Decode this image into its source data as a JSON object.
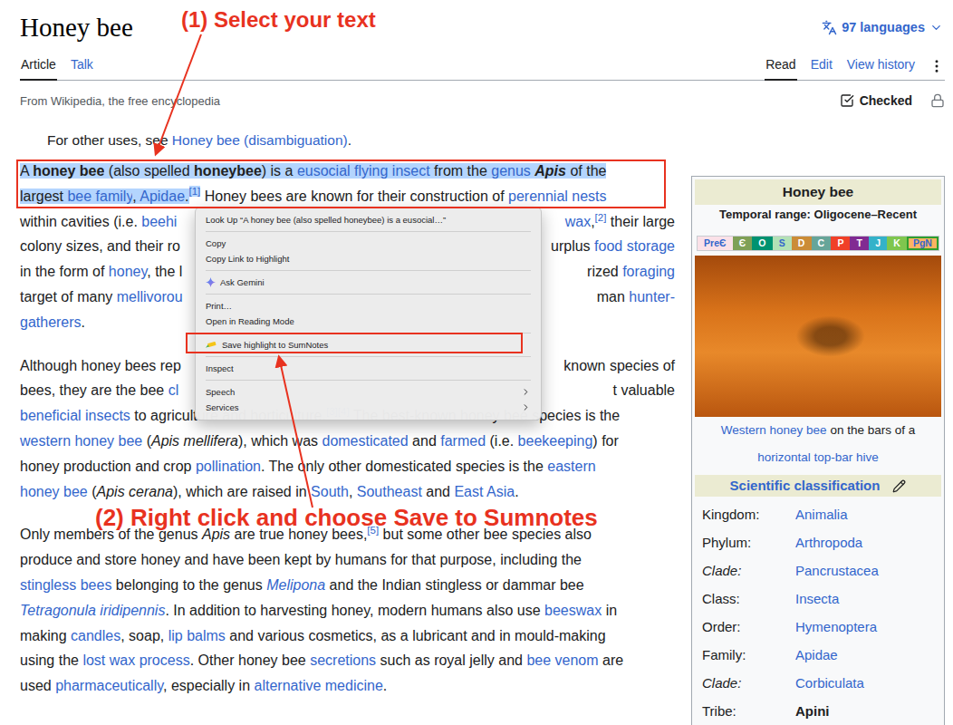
{
  "window": {
    "title": "Honey bee"
  },
  "header": {
    "title": "Honey bee",
    "languages": "97 languages"
  },
  "tabs_left": [
    {
      "label": "Article",
      "selected": true
    },
    {
      "label": "Talk",
      "selected": false
    }
  ],
  "tabs_right": [
    {
      "label": "Read",
      "selected": true
    },
    {
      "label": "Edit",
      "selected": false
    },
    {
      "label": "View history",
      "selected": false
    }
  ],
  "tagline": "From Wikipedia, the free encyclopedia",
  "status": {
    "label": "Checked"
  },
  "hatnote": [
    {
      "t": "For other uses, see ",
      "kind": "plain"
    },
    {
      "t": "Honey bee (disambiguation)",
      "kind": "link"
    },
    {
      "t": ".",
      "kind": "plain"
    }
  ],
  "paragraphs": [
    [
      {
        "covered": false,
        "parts": [
          {
            "t": "A ",
            "kind": "plain",
            "selected": true
          },
          {
            "t": "honey bee",
            "kind": "bold",
            "selected": true
          },
          {
            "t": " (also spelled ",
            "kind": "plain",
            "selected": true
          },
          {
            "t": "honeybee",
            "kind": "bold",
            "selected": true
          },
          {
            "t": ") is a ",
            "kind": "plain",
            "selected": true
          },
          {
            "t": "eusocial flying insect",
            "kind": "link",
            "selected": true
          },
          {
            "t": " from the ",
            "kind": "plain",
            "selected": true
          },
          {
            "t": "genus",
            "kind": "link",
            "selected": true
          },
          {
            "t": " ",
            "kind": "plain",
            "selected": true
          },
          {
            "t": "Apis",
            "kind": "bold-italic",
            "selected": true
          },
          {
            "t": " of the",
            "kind": "plain",
            "selected": true
          }
        ],
        "after": []
      },
      {
        "covered": false,
        "parts": [
          {
            "t": "largest ",
            "kind": "plain",
            "selected": true
          },
          {
            "t": "bee family",
            "kind": "link",
            "selected": true
          },
          {
            "t": ", ",
            "kind": "plain",
            "selected": true
          },
          {
            "t": "Apidae",
            "kind": "link",
            "selected": true
          },
          {
            "t": ".",
            "kind": "plain",
            "selected": true
          },
          {
            "t": "[1]",
            "kind": "ref",
            "selected": true
          },
          {
            "t": " Honey bees are known for their construction of ",
            "kind": "plain",
            "selected": false
          },
          {
            "t": "perennial nests",
            "kind": "link",
            "selected": false
          }
        ],
        "after": []
      },
      {
        "covered": true,
        "parts": [
          {
            "t": "within cavities (i.e. ",
            "kind": "plain"
          },
          {
            "t": "beehi",
            "kind": "link"
          }
        ],
        "after": [
          {
            "t": "wax",
            "kind": "link"
          },
          {
            "t": ",",
            "kind": "plain"
          },
          {
            "t": "[2]",
            "kind": "ref"
          },
          {
            "t": " their large",
            "kind": "plain"
          }
        ]
      },
      {
        "covered": true,
        "parts": [
          {
            "t": "colony sizes, and their ro",
            "kind": "plain"
          }
        ],
        "after": [
          {
            "t": "urplus ",
            "kind": "plain"
          },
          {
            "t": "food storage",
            "kind": "link"
          }
        ]
      },
      {
        "covered": true,
        "parts": [
          {
            "t": "in the form of ",
            "kind": "plain"
          },
          {
            "t": "honey",
            "kind": "link"
          },
          {
            "t": ", the l",
            "kind": "plain"
          }
        ],
        "after": [
          {
            "t": "rized ",
            "kind": "plain"
          },
          {
            "t": "foraging",
            "kind": "link"
          }
        ]
      },
      {
        "covered": true,
        "parts": [
          {
            "t": "target of many ",
            "kind": "plain"
          },
          {
            "t": "mellivorou",
            "kind": "link"
          }
        ],
        "after": [
          {
            "t": "man ",
            "kind": "plain"
          },
          {
            "t": "hunter-",
            "kind": "link"
          }
        ]
      },
      {
        "covered": false,
        "parts": [
          {
            "t": "gatherers",
            "kind": "link"
          },
          {
            "t": ".",
            "kind": "plain"
          }
        ],
        "after": []
      }
    ],
    [
      {
        "covered": true,
        "parts": [
          {
            "t": "Although honey bees rep",
            "kind": "plain"
          }
        ],
        "after": [
          {
            "t": "known species of",
            "kind": "plain"
          }
        ]
      },
      {
        "covered": true,
        "parts": [
          {
            "t": "bees, they are the bee ",
            "kind": "plain"
          },
          {
            "t": "cl",
            "kind": "link"
          }
        ],
        "after": [
          {
            "t": "t valuable",
            "kind": "plain"
          }
        ]
      },
      {
        "covered": false,
        "parts": [
          {
            "t": "beneficial insects",
            "kind": "link"
          },
          {
            "t": " to agriculture and horticulture.",
            "kind": "plain"
          },
          {
            "t": "[3][4]",
            "kind": "ref"
          },
          {
            "t": " The best-known honey bee species is the",
            "kind": "plain"
          }
        ],
        "after": []
      },
      {
        "covered": false,
        "parts": [
          {
            "t": "western honey bee",
            "kind": "link"
          },
          {
            "t": " (",
            "kind": "plain"
          },
          {
            "t": "Apis mellifera",
            "kind": "italic"
          },
          {
            "t": "), which was ",
            "kind": "plain"
          },
          {
            "t": "domesticated",
            "kind": "link"
          },
          {
            "t": " and ",
            "kind": "plain"
          },
          {
            "t": "farmed",
            "kind": "link"
          },
          {
            "t": " (i.e. ",
            "kind": "plain"
          },
          {
            "t": "beekeeping",
            "kind": "link"
          },
          {
            "t": ") for",
            "kind": "plain"
          }
        ],
        "after": []
      },
      {
        "covered": false,
        "parts": [
          {
            "t": "honey production and crop ",
            "kind": "plain"
          },
          {
            "t": "pollination",
            "kind": "link"
          },
          {
            "t": ". The only other domesticated species is the ",
            "kind": "plain"
          },
          {
            "t": "eastern",
            "kind": "link"
          }
        ],
        "after": []
      },
      {
        "covered": false,
        "parts": [
          {
            "t": "honey bee",
            "kind": "link"
          },
          {
            "t": " (",
            "kind": "plain"
          },
          {
            "t": "Apis cerana",
            "kind": "italic"
          },
          {
            "t": "), which are raised in ",
            "kind": "plain"
          },
          {
            "t": "South",
            "kind": "link"
          },
          {
            "t": ", ",
            "kind": "plain"
          },
          {
            "t": "Southeast",
            "kind": "link"
          },
          {
            "t": " and ",
            "kind": "plain"
          },
          {
            "t": "East Asia",
            "kind": "link"
          },
          {
            "t": ".",
            "kind": "plain"
          }
        ],
        "after": []
      }
    ],
    [
      {
        "covered": false,
        "parts": [
          {
            "t": "Only members of the genus ",
            "kind": "plain"
          },
          {
            "t": "Apis",
            "kind": "italic"
          },
          {
            "t": " are true honey bees,",
            "kind": "plain"
          },
          {
            "t": "[5]",
            "kind": "ref"
          },
          {
            "t": " but some other bee species also",
            "kind": "plain"
          }
        ],
        "after": []
      },
      {
        "covered": false,
        "parts": [
          {
            "t": "produce and store honey and have been kept by humans for that purpose, including the",
            "kind": "plain"
          }
        ],
        "after": []
      },
      {
        "covered": false,
        "parts": [
          {
            "t": "stingless bees",
            "kind": "link"
          },
          {
            "t": " belonging to the genus ",
            "kind": "plain"
          },
          {
            "t": "Melipona",
            "kind": "link-italic"
          },
          {
            "t": " and the Indian stingless or dammar bee",
            "kind": "plain"
          }
        ],
        "after": []
      },
      {
        "covered": false,
        "parts": [
          {
            "t": "Tetragonula iridipennis",
            "kind": "link-italic"
          },
          {
            "t": ". In addition to harvesting honey, modern humans also use ",
            "kind": "plain"
          },
          {
            "t": "beeswax",
            "kind": "link"
          },
          {
            "t": " in",
            "kind": "plain"
          }
        ],
        "after": []
      },
      {
        "covered": false,
        "parts": [
          {
            "t": "making ",
            "kind": "plain"
          },
          {
            "t": "candles",
            "kind": "link"
          },
          {
            "t": ", soap, ",
            "kind": "plain"
          },
          {
            "t": "lip balms",
            "kind": "link"
          },
          {
            "t": " and various cosmetics, as a lubricant and in mould-making",
            "kind": "plain"
          }
        ],
        "after": []
      },
      {
        "covered": false,
        "parts": [
          {
            "t": "using the ",
            "kind": "plain"
          },
          {
            "t": "lost wax process",
            "kind": "link"
          },
          {
            "t": ". Other honey bee ",
            "kind": "plain"
          },
          {
            "t": "secretions",
            "kind": "link"
          },
          {
            "t": " such as royal jelly and ",
            "kind": "plain"
          },
          {
            "t": "bee venom",
            "kind": "link"
          },
          {
            "t": " are",
            "kind": "plain"
          }
        ],
        "after": []
      },
      {
        "covered": false,
        "parts": [
          {
            "t": "used ",
            "kind": "plain"
          },
          {
            "t": "pharmaceutically",
            "kind": "link"
          },
          {
            "t": ", especially in ",
            "kind": "plain"
          },
          {
            "t": "alternative medicine",
            "kind": "link"
          },
          {
            "t": ".",
            "kind": "plain"
          }
        ],
        "after": []
      }
    ]
  ],
  "infobox": {
    "title": "Honey bee",
    "range": "Temporal range: Oligocene–Recent",
    "periods": [
      {
        "label": "PreЄ",
        "color": "#fbe1e8",
        "current": false
      },
      {
        "label": "Є",
        "color": "#7fa056",
        "current": false
      },
      {
        "label": "O",
        "color": "#009270",
        "current": false
      },
      {
        "label": "S",
        "color": "#b3e1b6",
        "current": false
      },
      {
        "label": "D",
        "color": "#cb8c37",
        "current": false
      },
      {
        "label": "C",
        "color": "#67a599",
        "current": false
      },
      {
        "label": "P",
        "color": "#f04028",
        "current": false
      },
      {
        "label": "T",
        "color": "#812b92",
        "current": false
      },
      {
        "label": "J",
        "color": "#34b2c9",
        "current": false
      },
      {
        "label": "K",
        "color": "#7fc64e",
        "current": false
      },
      {
        "label": "PgN",
        "color": "#fdb462",
        "current": true
      }
    ],
    "caption": [
      {
        "t": "Western honey bee",
        "kind": "link"
      },
      {
        "t": " on the bars of a ",
        "kind": "plain"
      },
      {
        "t": "horizontal top-bar hive",
        "kind": "link"
      }
    ],
    "classification_title": "Scientific classification",
    "rows": [
      {
        "rank": "Kingdom:",
        "italic": false,
        "value": "Animalia",
        "kind": "link"
      },
      {
        "rank": "Phylum:",
        "italic": false,
        "value": "Arthropoda",
        "kind": "link"
      },
      {
        "rank": "Clade:",
        "italic": true,
        "value": "Pancrustacea",
        "kind": "link"
      },
      {
        "rank": "Class:",
        "italic": false,
        "value": "Insecta",
        "kind": "link"
      },
      {
        "rank": "Order:",
        "italic": false,
        "value": "Hymenoptera",
        "kind": "link"
      },
      {
        "rank": "Family:",
        "italic": false,
        "value": "Apidae",
        "kind": "link"
      },
      {
        "rank": "Clade:",
        "italic": true,
        "value": "Corbiculata",
        "kind": "link"
      },
      {
        "rank": "Tribe:",
        "italic": false,
        "value": "Apini",
        "kind": "bold"
      }
    ]
  },
  "context_menu": [
    {
      "label": "Look Up “A honey bee (also spelled honeybee) is a eusocial…”",
      "kind": "plain"
    },
    {
      "label": "",
      "kind": "separator"
    },
    {
      "label": "Copy",
      "kind": "plain"
    },
    {
      "label": "Copy Link to Highlight",
      "kind": "plain"
    },
    {
      "label": "",
      "kind": "separator"
    },
    {
      "label": "Ask Gemini",
      "kind": "gemini"
    },
    {
      "label": "",
      "kind": "separator"
    },
    {
      "label": "Print…",
      "kind": "plain"
    },
    {
      "label": "Open in Reading Mode",
      "kind": "plain"
    },
    {
      "label": "",
      "kind": "separator"
    },
    {
      "label": "Save highlight to SumNotes",
      "kind": "extension"
    },
    {
      "label": "",
      "kind": "separator"
    },
    {
      "label": "Inspect",
      "kind": "plain"
    },
    {
      "label": "",
      "kind": "separator"
    },
    {
      "label": "Speech",
      "kind": "submenu"
    },
    {
      "label": "Services",
      "kind": "submenu"
    }
  ],
  "annotations": {
    "step1": "(1) Select your text",
    "step2": "(2) Right click and choose Save to Sumnotes"
  }
}
